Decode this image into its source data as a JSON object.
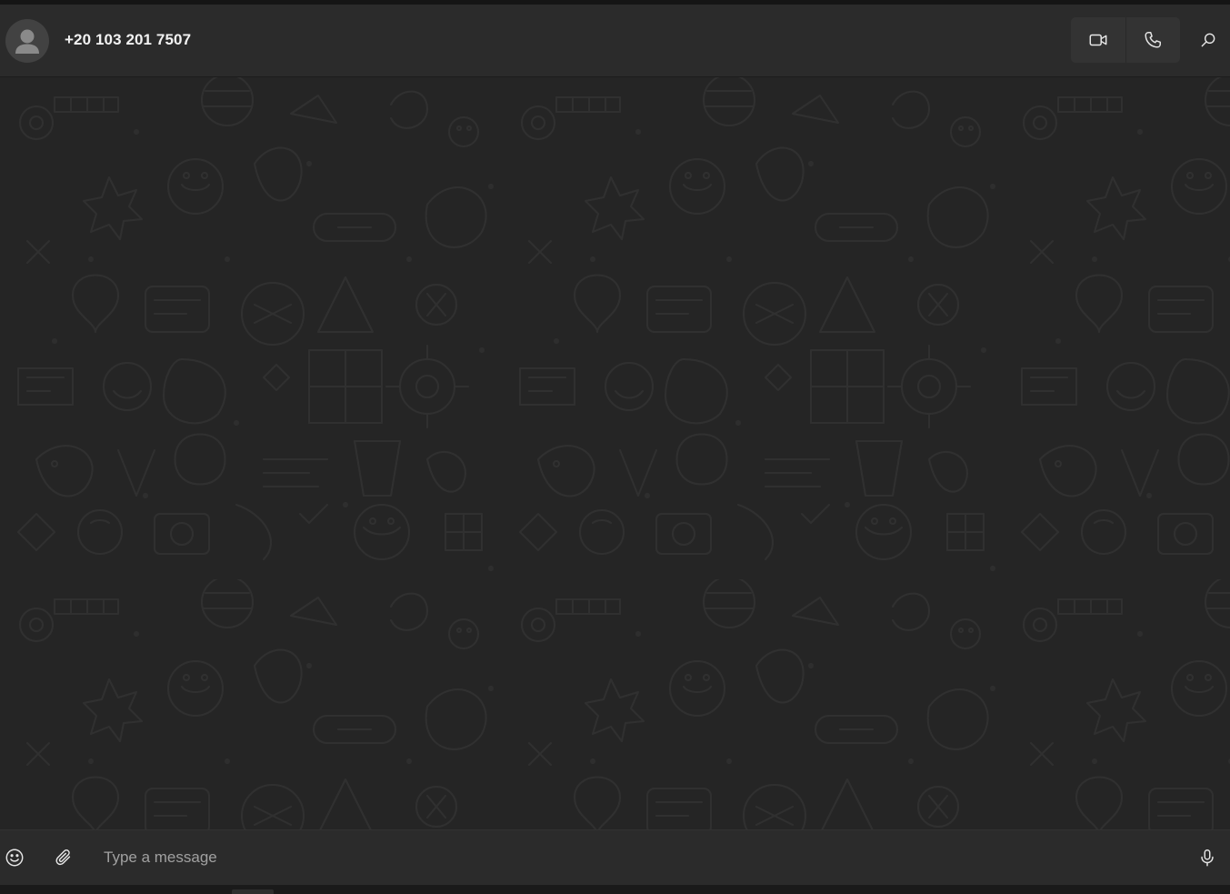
{
  "header": {
    "contact_name": "+20 103 201 7507",
    "avatar_icon": "person-silhouette-icon",
    "video_call_icon": "video-camera-icon",
    "voice_call_icon": "phone-icon",
    "search_icon": "search-icon"
  },
  "composer": {
    "placeholder": "Type a message",
    "value": "",
    "emoji_icon": "smiley-icon",
    "attach_icon": "paperclip-icon",
    "mic_icon": "microphone-icon"
  },
  "colors": {
    "header_bg": "#2b2b2b",
    "chat_bg": "#252525",
    "doodle_stroke": "#2f2f2f",
    "icon": "#e6e6e6",
    "placeholder": "#a0a0a0"
  }
}
